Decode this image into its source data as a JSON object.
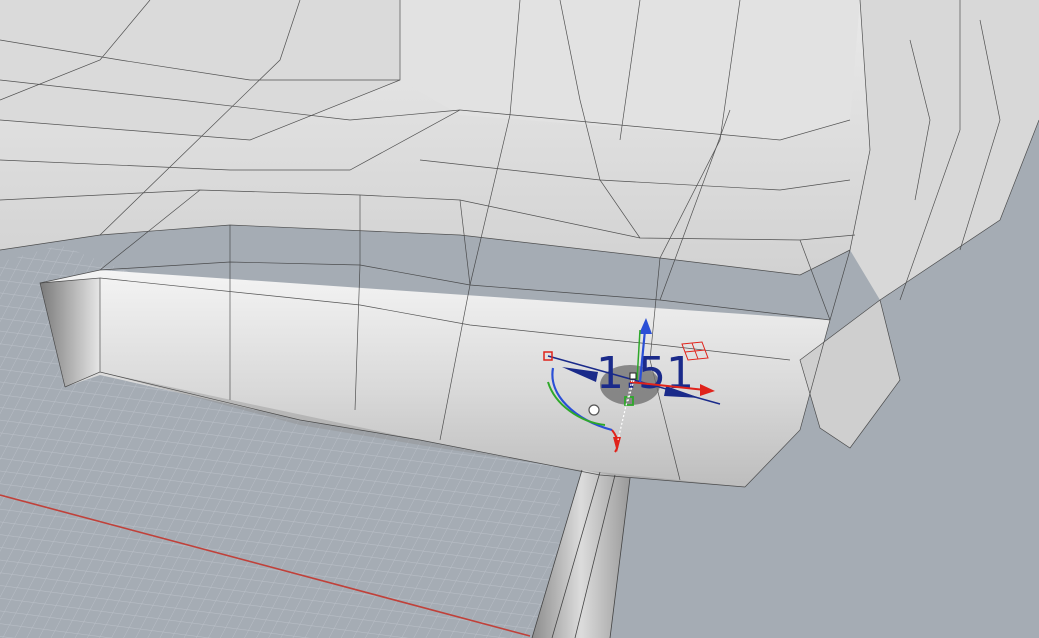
{
  "viewport": {
    "background_color": "#a5acb4",
    "grid_color": "#b8bec6",
    "grid_major_color": "#9ea5ad",
    "x_axis_color": "#c0413a",
    "model_face_color": "#e6e6e6",
    "wire_color": "#3a3a3a"
  },
  "gumball": {
    "dimension_text": "1.51",
    "x_axis_color": "#e0231b",
    "y_axis_color": "#2ea82a",
    "z_axis_color": "#2a4fd6",
    "dimension_color": "#1a2a8a",
    "icons": [
      "move-arrow-icon",
      "rotate-arc-icon",
      "scale-handle-icon",
      "plane-grid-icon"
    ]
  }
}
